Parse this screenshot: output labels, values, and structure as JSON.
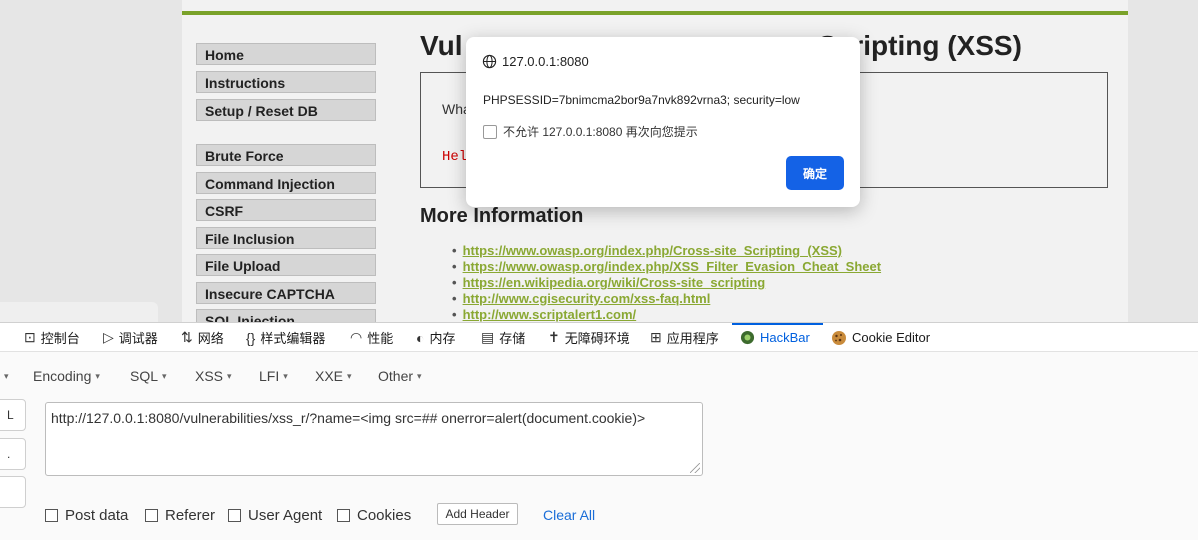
{
  "page": {
    "menu": [
      {
        "label": "Home",
        "top": 0
      },
      {
        "label": "Instructions"
      },
      {
        "label": "Setup / Reset DB"
      },
      {
        "label": "Brute Force"
      },
      {
        "label": "Command Injection"
      },
      {
        "label": "CSRF"
      },
      {
        "label": "File Inclusion"
      },
      {
        "label": "File Upload"
      },
      {
        "label": "Insecure CAPTCHA"
      },
      {
        "label": "SQL Injection"
      }
    ],
    "title": "Vulnerability: Reflected Cross Site Scripting (XSS)",
    "title_visible_left": "Vul",
    "title_visible_right": "Scripting (XSS)",
    "prompt_visible": "Wha",
    "hello_visible": "Hel",
    "more_info": "More Information",
    "links": [
      "https://www.owasp.org/index.php/Cross-site_Scripting_(XSS)",
      "https://www.owasp.org/index.php/XSS_Filter_Evasion_Cheat_Sheet",
      "https://en.wikipedia.org/wiki/Cross-site_scripting",
      "http://www.cgisecurity.com/xss-faq.html",
      "http://www.scriptalert1.com/"
    ]
  },
  "alert": {
    "origin": "127.0.0.1:8080",
    "message": "PHPSESSID=7bnimcma2bor9a7nvk892vrna3; security=low",
    "checkbox_label": "不允许 127.0.0.1:8080 再次向您提示",
    "ok_label": "确定"
  },
  "devtools": {
    "tabs": [
      {
        "label": "控制台",
        "icon": "console-icon"
      },
      {
        "label": "调试器",
        "icon": "debugger-icon"
      },
      {
        "label": "网络",
        "icon": "network-icon"
      },
      {
        "label": "样式编辑器",
        "icon": "style-editor-icon"
      },
      {
        "label": "性能",
        "icon": "performance-icon"
      },
      {
        "label": "内存",
        "icon": "memory-icon"
      },
      {
        "label": "存储",
        "icon": "storage-icon"
      },
      {
        "label": "无障碍环境",
        "icon": "accessibility-icon"
      },
      {
        "label": "应用程序",
        "icon": "application-icon"
      },
      {
        "label": "HackBar",
        "icon": "hackbar-icon"
      },
      {
        "label": "Cookie Editor",
        "icon": "cookie-icon"
      }
    ],
    "active_tab": "HackBar",
    "accent_color": "#0060df"
  },
  "hackbar": {
    "menus": [
      "Encoding",
      "SQL",
      "XSS",
      "LFI",
      "XXE",
      "Other"
    ],
    "side_buttons": [
      "L",
      ".",
      ""
    ],
    "url": "http://127.0.0.1:8080/vulnerabilities/xss_r/?name=<img src=## onerror=alert(document.cookie)>",
    "options": [
      "Post data",
      "Referer",
      "User Agent",
      "Cookies"
    ],
    "add_header_label": "Add Header",
    "clear_all_label": "Clear All"
  }
}
